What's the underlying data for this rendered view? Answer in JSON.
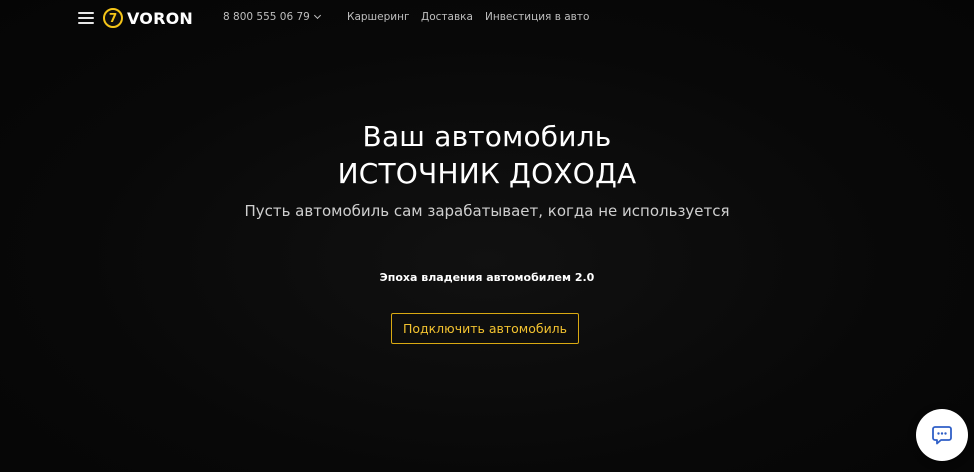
{
  "header": {
    "menu_icon": "hamburger-menu-icon",
    "logo": {
      "mark": "7",
      "text": "VORON",
      "mark_color": "#f5c518"
    },
    "phone": {
      "number": "8 800 555 06 79",
      "icon": "chevron-down-icon"
    },
    "nav": [
      {
        "label": "Каршеринг"
      },
      {
        "label": "Доставка"
      },
      {
        "label": "Инвестиция в авто"
      }
    ]
  },
  "hero": {
    "title_line1": "Ваш автомобиль",
    "title_line2": "ИСТОЧНИК ДОХОДА",
    "subtitle": "Пусть автомобиль сам зарабатывает, когда не используется",
    "epoch": "Эпоха владения автомобилем 2.0",
    "cta_label": "Подключить автомобиль"
  },
  "chat_widget": {
    "icon": "chat-bubble-icon",
    "accent": "#2f5fc7"
  },
  "colors": {
    "background": "#070707",
    "accent": "#f5c518",
    "text": "#ffffff",
    "muted": "#bfbfbf"
  }
}
